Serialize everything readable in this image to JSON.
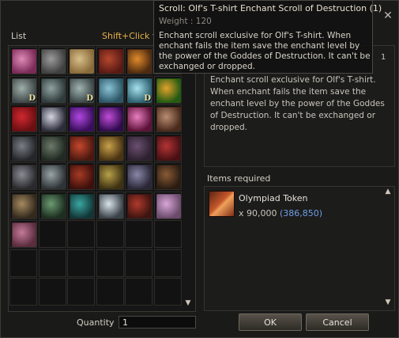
{
  "window": {
    "close_glyph": "✕"
  },
  "list": {
    "label": "List",
    "shift_hint": "Shift+Click f",
    "scroll_up": "▲",
    "scroll_down": "▼",
    "cells": [
      {
        "icon": "pink-gift-box-icon",
        "colors": [
          "#7a2b57",
          "#e08ab8"
        ],
        "d": ""
      },
      {
        "icon": "gray-star-badge-icon",
        "colors": [
          "#3f3f3f",
          "#9b9b9b"
        ],
        "d": ""
      },
      {
        "icon": "paper-scroll-icon",
        "colors": [
          "#8a6a3a",
          "#d8c08a"
        ],
        "d": ""
      },
      {
        "icon": "red-book-icon",
        "colors": [
          "#5a1a14",
          "#b4472d"
        ],
        "d": ""
      },
      {
        "icon": "orange-potion-icon",
        "colors": [
          "#4e2a10",
          "#e08b2a"
        ],
        "d": ""
      },
      {
        "icon": "silver-scroll-icon",
        "colors": [
          "#4a5454",
          "#a7b6b2"
        ],
        "d": ""
      },
      {
        "icon": "enchant-scroll-d-icon",
        "colors": [
          "#3d4546",
          "#9fb0aa"
        ],
        "d": "D"
      },
      {
        "icon": "enchant-scroll-d2-icon",
        "colors": [
          "#2f3a3b",
          "#8fa3a0"
        ],
        "d": ""
      },
      {
        "icon": "enchant-scroll-d3-icon",
        "colors": [
          "#3a4546",
          "#a0b4b0"
        ],
        "d": "D"
      },
      {
        "icon": "blue-scroll-icon",
        "colors": [
          "#2b5565",
          "#8ac3d6"
        ],
        "d": ""
      },
      {
        "icon": "blue-scroll-d-icon",
        "colors": [
          "#2c6070",
          "#a8e2ee"
        ],
        "d": "D"
      },
      {
        "icon": "green-slash-icon",
        "colors": [
          "#235a12",
          "#e3a12a"
        ],
        "d": ""
      },
      {
        "icon": "red-orb-icon",
        "colors": [
          "#6a0f12",
          "#d1282f"
        ],
        "d": ""
      },
      {
        "icon": "white-ghost-icon",
        "colors": [
          "#2c2c3a",
          "#d3d6e0"
        ],
        "d": ""
      },
      {
        "icon": "purple-wind-icon",
        "colors": [
          "#3a0e5c",
          "#b047e0"
        ],
        "d": ""
      },
      {
        "icon": "purple-swirl-icon",
        "colors": [
          "#300b4e",
          "#c04cd8"
        ],
        "d": ""
      },
      {
        "icon": "pink-heart-icon",
        "colors": [
          "#5c1238",
          "#e87ec0"
        ],
        "d": ""
      },
      {
        "icon": "armored-warrior-icon",
        "colors": [
          "#4a2a1c",
          "#b98e72"
        ],
        "d": ""
      },
      {
        "icon": "dark-knight-icon",
        "colors": [
          "#24262a",
          "#7a7f86"
        ],
        "d": ""
      },
      {
        "icon": "hooded-figure-icon",
        "colors": [
          "#202a22",
          "#6c7a6a"
        ],
        "d": ""
      },
      {
        "icon": "red-armor-icon",
        "colors": [
          "#4c1810",
          "#c4472c"
        ],
        "d": ""
      },
      {
        "icon": "gold-armor-icon",
        "colors": [
          "#4a3412",
          "#c9a14a"
        ],
        "d": ""
      },
      {
        "icon": "bear-costume-icon",
        "colors": [
          "#2e2030",
          "#6a5070"
        ],
        "d": ""
      },
      {
        "icon": "red-cape-icon",
        "colors": [
          "#481014",
          "#b33434"
        ],
        "d": ""
      },
      {
        "icon": "steel-armor-icon",
        "colors": [
          "#2a2a2e",
          "#8a8c94"
        ],
        "d": ""
      },
      {
        "icon": "stone-mask-icon",
        "colors": [
          "#2e3336",
          "#9aa4a8"
        ],
        "d": ""
      },
      {
        "icon": "crimson-armor-icon",
        "colors": [
          "#3e100c",
          "#a63a24"
        ],
        "d": ""
      },
      {
        "icon": "gold-helmet-icon",
        "colors": [
          "#3e3212",
          "#b8a04a"
        ],
        "d": ""
      },
      {
        "icon": "wolf-head-icon",
        "colors": [
          "#2a2838",
          "#8a86a8"
        ],
        "d": ""
      },
      {
        "icon": "brown-robe-icon",
        "colors": [
          "#2a1c12",
          "#8a5a36"
        ],
        "d": ""
      },
      {
        "icon": "tan-robe-icon",
        "colors": [
          "#342a1c",
          "#a68a62"
        ],
        "d": ""
      },
      {
        "icon": "green-robe-icon",
        "colors": [
          "#1c2e20",
          "#6c9a72"
        ],
        "d": ""
      },
      {
        "icon": "teal-dress-icon",
        "colors": [
          "#123636",
          "#3aa6a2"
        ],
        "d": ""
      },
      {
        "icon": "white-dress-icon",
        "colors": [
          "#3a4248",
          "#d8e4ea"
        ],
        "d": ""
      },
      {
        "icon": "red-dress-icon",
        "colors": [
          "#3e1410",
          "#b03a2c"
        ],
        "d": ""
      },
      {
        "icon": "pink-scroll-icon",
        "colors": [
          "#6a4a6a",
          "#d8a6d8"
        ],
        "d": ""
      },
      {
        "icon": "pink-scroll-2-icon",
        "colors": [
          "#5a2c3e",
          "#c47a96"
        ],
        "d": ""
      }
    ]
  },
  "description": {
    "text": "Enchant scroll exclusive for Olf's T-shirt. When enchant fails the item save the enchant level by the power of the Goddes of Destruction. It can't be exchanged or dropped.",
    "truncated_tail": "1"
  },
  "requirements": {
    "label": "Items required",
    "item_name": "Olympiad Token",
    "item_qty": "x 90,000",
    "item_have": "(386,850)",
    "scroll_up": "▲",
    "scroll_down": "▼"
  },
  "quantity": {
    "label": "Quantity",
    "value": "1"
  },
  "buttons": {
    "ok": "OK",
    "cancel": "Cancel"
  },
  "tooltip": {
    "title": "Scroll: Olf's T-shirt Enchant Scroll of Destruction (1)",
    "weight": "Weight : 120",
    "desc": "Enchant scroll exclusive for Olf's T-shirt. When enchant fails the item save the enchant level by the power of the Goddes of Destruction. It can't be exchanged or dropped."
  }
}
